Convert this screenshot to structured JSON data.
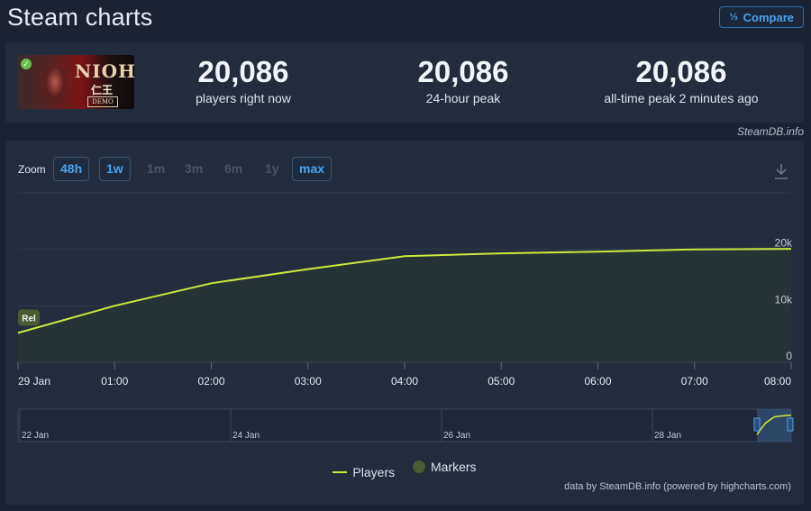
{
  "page": {
    "title": "Steam charts"
  },
  "compare": {
    "label": "Compare",
    "icon": "compare-fraction-icon"
  },
  "game": {
    "logo_text": "NIOH",
    "logo_sub": "仁王",
    "logo_tag": "DEMO",
    "badge": "✓"
  },
  "stats": [
    {
      "value": "20,086",
      "label": "players right now"
    },
    {
      "value": "20,086",
      "label": "24-hour peak"
    },
    {
      "value": "20,086",
      "label": "all-time peak 2 minutes ago"
    }
  ],
  "attribution": "SteamDB.info",
  "zoom": {
    "label": "Zoom",
    "buttons": [
      {
        "label": "48h",
        "active": true
      },
      {
        "label": "1w",
        "active": true
      },
      {
        "label": "1m",
        "active": false
      },
      {
        "label": "3m",
        "active": false
      },
      {
        "label": "6m",
        "active": false
      },
      {
        "label": "1y",
        "active": false
      },
      {
        "label": "max",
        "active": true
      }
    ]
  },
  "chart_data": {
    "type": "area",
    "series": [
      {
        "name": "Players",
        "color": "#cde83f",
        "x": [
          "00:00",
          "01:00",
          "02:00",
          "03:00",
          "04:00",
          "05:00",
          "06:00",
          "07:00",
          "08:00"
        ],
        "values": [
          5200,
          10000,
          14000,
          16500,
          18800,
          19300,
          19600,
          20000,
          20086
        ]
      }
    ],
    "x_tick_labels": [
      "29 Jan",
      "01:00",
      "02:00",
      "03:00",
      "04:00",
      "05:00",
      "06:00",
      "07:00",
      "08:00"
    ],
    "y_ticks": [
      0,
      10000,
      20000
    ],
    "y_tick_labels": [
      "0",
      "10k",
      "20k"
    ],
    "ylim": [
      0,
      30000
    ],
    "grid": true,
    "marker": {
      "label": "Rel",
      "x": "00:00"
    },
    "navigator": {
      "labels": [
        "22 Jan",
        "24 Jan",
        "26 Jan",
        "28 Jan"
      ]
    },
    "legend": [
      "Players",
      "Markers"
    ],
    "legend_position": "bottom-center",
    "credits": "data by SteamDB.info (powered by highcharts.com)"
  }
}
